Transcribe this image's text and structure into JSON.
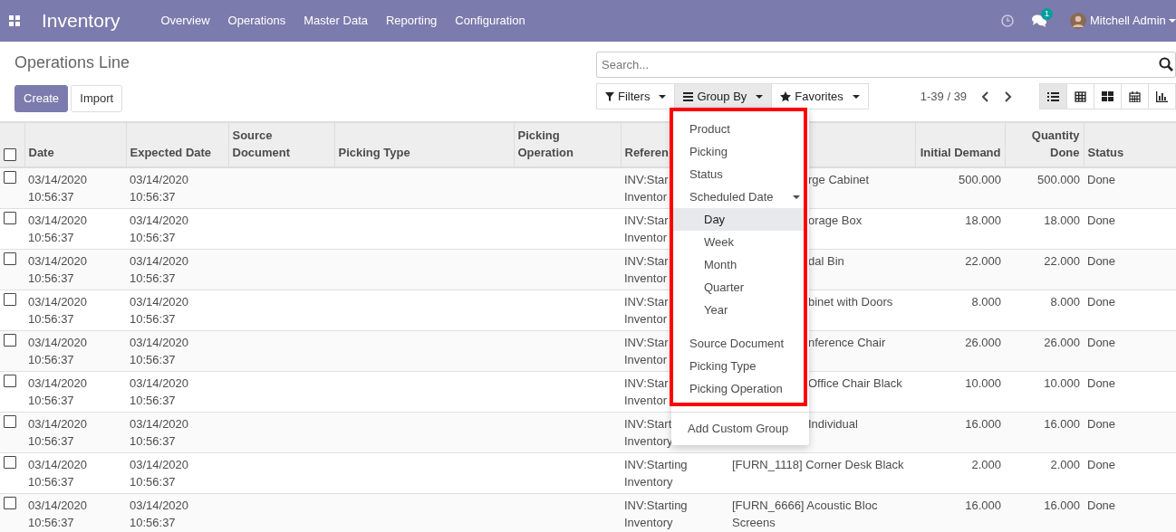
{
  "navbar": {
    "app": "Inventory",
    "menu": [
      "Overview",
      "Operations",
      "Master Data",
      "Reporting",
      "Configuration"
    ],
    "messages_badge": "1",
    "user": "Mitchell Admin"
  },
  "title": "Operations Line",
  "buttons": [
    {
      "label": "Create",
      "kind": "primary"
    },
    {
      "label": "Import",
      "kind": "secondary"
    }
  ],
  "search": {
    "placeholder": "Search..."
  },
  "search_options": [
    {
      "label": "Filters",
      "kind": "filter",
      "open": false
    },
    {
      "label": "Group By",
      "kind": "group",
      "open": true
    },
    {
      "label": "Favorites",
      "kind": "star",
      "open": false
    }
  ],
  "pager": "1-39 / 39",
  "views": [
    {
      "kind": "list",
      "selected": true
    },
    {
      "kind": "grid",
      "selected": false
    },
    {
      "kind": "kanban",
      "selected": false
    },
    {
      "kind": "calendar",
      "selected": false
    },
    {
      "kind": "graph",
      "selected": false
    }
  ],
  "table": {
    "select_all_checked": false,
    "columns": [
      {
        "label": "Date",
        "kind": "text"
      },
      {
        "label": "Expected Date",
        "kind": "text"
      },
      {
        "label": "Source Document",
        "kind": "text"
      },
      {
        "label": "Picking Type",
        "kind": "text"
      },
      {
        "label": "Picking Operation",
        "kind": "text"
      },
      {
        "label": "Referen",
        "kind": "text"
      },
      {
        "kind": "text"
      },
      {
        "label": "Initial Demand",
        "kind": "number"
      },
      {
        "label": "Quantity Done",
        "kind": "number"
      },
      {
        "label": "Status",
        "kind": "text"
      }
    ],
    "rows": [
      {
        "checked": false,
        "covered": true,
        "cells": [
          [
            "03/14/2020",
            "10:56:37"
          ],
          [
            "03/14/2020",
            "10:56:37"
          ],
          [],
          [],
          [],
          [
            "INV:Star",
            "Inventor"
          ],
          [
            "rge Cabinet"
          ],
          [
            "500.000"
          ],
          [
            "500.000"
          ],
          [
            "Done"
          ]
        ]
      },
      {
        "checked": false,
        "covered": true,
        "cells": [
          [
            "03/14/2020",
            "10:56:37"
          ],
          [
            "03/14/2020",
            "10:56:37"
          ],
          [],
          [],
          [],
          [
            "INV:Star",
            "Inventor"
          ],
          [
            "orage Box"
          ],
          [
            "18.000"
          ],
          [
            "18.000"
          ],
          [
            "Done"
          ]
        ]
      },
      {
        "checked": false,
        "covered": true,
        "cells": [
          [
            "03/14/2020",
            "10:56:37"
          ],
          [
            "03/14/2020",
            "10:56:37"
          ],
          [],
          [],
          [],
          [
            "INV:Star",
            "Inventor"
          ],
          [
            "dal Bin"
          ],
          [
            "22.000"
          ],
          [
            "22.000"
          ],
          [
            "Done"
          ]
        ]
      },
      {
        "checked": false,
        "covered": true,
        "cells": [
          [
            "03/14/2020",
            "10:56:37"
          ],
          [
            "03/14/2020",
            "10:56:37"
          ],
          [],
          [],
          [],
          [
            "INV:Star",
            "Inventor"
          ],
          [
            "binet with Doors"
          ],
          [
            "8.000"
          ],
          [
            "8.000"
          ],
          [
            "Done"
          ]
        ]
      },
      {
        "checked": false,
        "covered": true,
        "cells": [
          [
            "03/14/2020",
            "10:56:37"
          ],
          [
            "03/14/2020",
            "10:56:37"
          ],
          [],
          [],
          [],
          [
            "INV:Star",
            "Inventor"
          ],
          [
            "nference Chair"
          ],
          [
            "26.000"
          ],
          [
            "26.000"
          ],
          [
            "Done"
          ]
        ]
      },
      {
        "checked": false,
        "covered": true,
        "cells": [
          [
            "03/14/2020",
            "10:56:37"
          ],
          [
            "03/14/2020",
            "10:56:37"
          ],
          [],
          [],
          [],
          [
            "INV:Star",
            "Inventor"
          ],
          [
            "Office Chair Black"
          ],
          [
            "10.000"
          ],
          [
            "10.000"
          ],
          [
            "Done"
          ]
        ]
      },
      {
        "checked": false,
        "covered": true,
        "cells": [
          [
            "03/14/2020",
            "10:56:37"
          ],
          [
            "03/14/2020",
            "10:56:37"
          ],
          [],
          [],
          [],
          [
            "INV:Start",
            "Inventory"
          ],
          [
            "Individual"
          ],
          [
            "16.000"
          ],
          [
            "16.000"
          ],
          [
            "Done"
          ]
        ]
      },
      {
        "checked": false,
        "covered": false,
        "cells": [
          [
            "03/14/2020",
            "10:56:37"
          ],
          [
            "03/14/2020",
            "10:56:37"
          ],
          [],
          [],
          [],
          [
            "INV:Starting",
            "Inventory"
          ],
          [
            "[FURN_1118] Corner Desk Black"
          ],
          [
            "2.000"
          ],
          [
            "2.000"
          ],
          [
            "Done"
          ]
        ]
      },
      {
        "checked": false,
        "covered": false,
        "cells": [
          [
            "03/14/2020",
            "10:56:37"
          ],
          [
            "03/14/2020",
            "10:56:37"
          ],
          [],
          [],
          [],
          [
            "INV:Starting",
            "Inventory"
          ],
          [
            "[FURN_6666] Acoustic Bloc",
            "Screens"
          ],
          [
            "16.000"
          ],
          [
            "16.000"
          ],
          [
            "Done"
          ]
        ]
      }
    ]
  },
  "group_by_menu": {
    "items": [
      {
        "label": "Product",
        "kind": "option",
        "selected": false
      },
      {
        "label": "Picking",
        "kind": "option",
        "selected": false
      },
      {
        "label": "Status",
        "kind": "option",
        "selected": false
      },
      {
        "label": "Scheduled Date",
        "kind": "parent",
        "expanded": true
      },
      {
        "label": "Day",
        "kind": "sub",
        "selected": true
      },
      {
        "label": "Week",
        "kind": "sub",
        "selected": false
      },
      {
        "label": "Month",
        "kind": "sub",
        "selected": false
      },
      {
        "label": "Quarter",
        "kind": "sub",
        "selected": false
      },
      {
        "label": "Year",
        "kind": "sub",
        "selected": false
      },
      {
        "label": "Source Document",
        "kind": "option",
        "selected": false
      },
      {
        "label": "Picking Type",
        "kind": "option",
        "selected": false
      },
      {
        "label": "Picking Operation",
        "kind": "option",
        "selected": false
      }
    ],
    "custom": "Add Custom Group"
  }
}
